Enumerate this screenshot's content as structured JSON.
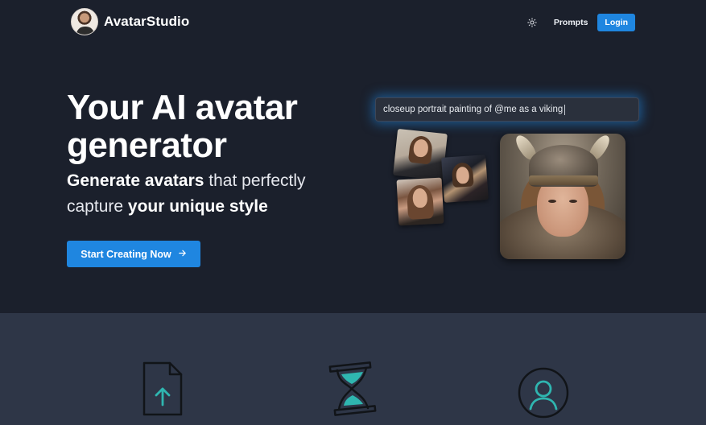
{
  "brand": {
    "name": "AvatarStudio",
    "logo_icon": "avatar-logo-icon"
  },
  "nav": {
    "theme_icon": "sun-icon",
    "prompts_label": "Prompts",
    "login_label": "Login"
  },
  "hero": {
    "title": "Your AI avatar generator",
    "subtitle_part1": "Generate avatars",
    "subtitle_part2": " that perfectly capture ",
    "subtitle_part3": "your unique style",
    "cta_label": "Start Creating Now",
    "cta_icon": "arrow-right-icon"
  },
  "prompt": {
    "text": "closeup portrait painting of @me as a viking"
  },
  "features": {
    "icons": [
      "file-upload-icon",
      "hourglass-icon",
      "user-circle-icon"
    ]
  },
  "colors": {
    "background": "#1b202c",
    "features_band": "#2e3647",
    "accent": "#1f86e0",
    "icon_teal": "#2fb6b0"
  }
}
